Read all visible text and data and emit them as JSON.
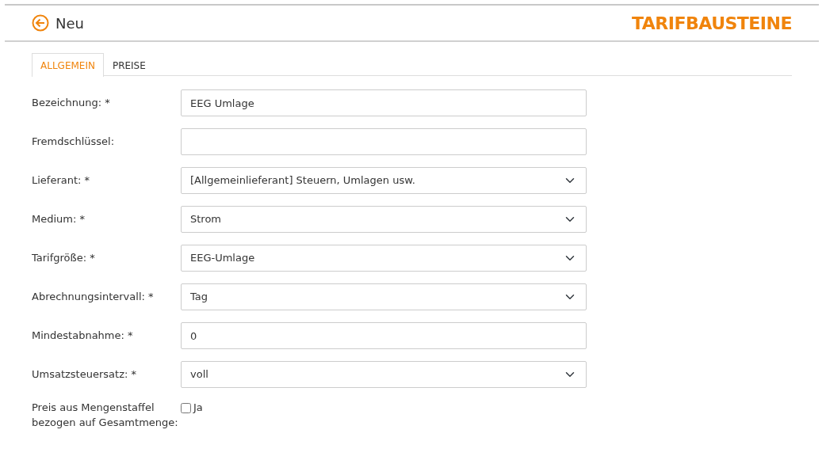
{
  "header": {
    "title": "Neu",
    "section": "TARIFBAUSTEINE"
  },
  "tabs": [
    {
      "label": "ALLGEMEIN",
      "selected": true
    },
    {
      "label": "PREISE",
      "selected": false
    }
  ],
  "fields": [
    {
      "label": "Bezeichnung: *",
      "kind": "text",
      "value": "EEG Umlage"
    },
    {
      "label": "Fremdschlüssel:",
      "kind": "text"
    },
    {
      "label": "Lieferant: *",
      "kind": "select",
      "value": "[Allgemeinlieferant] Steuern, Umlagen usw."
    },
    {
      "label": "Medium: *",
      "kind": "select",
      "value": "Strom"
    },
    {
      "label": "Tarifgröße: *",
      "kind": "select",
      "value": "EEG-Umlage"
    },
    {
      "label": "Abrechnungsintervall: *",
      "kind": "select",
      "value": "Tag"
    },
    {
      "label": "Mindestabnahme: *",
      "kind": "text",
      "value": "0"
    },
    {
      "label": "Umsatzsteuersatz: *",
      "kind": "select",
      "value": "voll"
    },
    {
      "label": "Preis aus Mengenstaffel bezogen auf Gesamtmenge:",
      "kind": "checkbox",
      "option": "Ja",
      "checked": false
    }
  ]
}
